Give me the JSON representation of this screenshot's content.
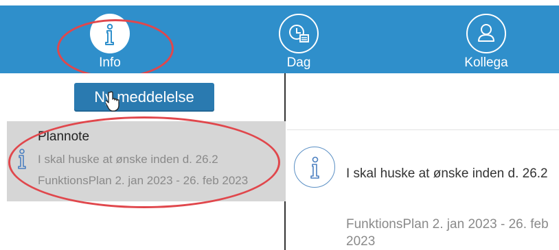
{
  "nav": {
    "tabs": [
      {
        "label": "Info",
        "icon": "info-icon",
        "active": true
      },
      {
        "label": "Dag",
        "icon": "calendar-clock-icon",
        "active": false
      },
      {
        "label": "Kollega",
        "icon": "person-icon",
        "active": false
      }
    ]
  },
  "sidebar": {
    "new_message_label": "Ny meddelelse",
    "messages": [
      {
        "title": "Plannote",
        "text": "I skal huske at ønske inden d. 26.2",
        "subtitle": "FunktionsPlan 2. jan 2023 - 26. feb 2023",
        "icon": "info-icon"
      }
    ]
  },
  "detail": {
    "text": "I skal huske at ønske inden d. 26.2",
    "subtitle": "FunktionsPlan 2. jan 2023 - 26. feb 2023",
    "icon": "info-icon"
  },
  "colors": {
    "nav_blue": "#2f8fcb",
    "button_blue": "#2a7ab0",
    "annotation_red": "#e0474c",
    "selected_gray": "#d6d6d6"
  }
}
